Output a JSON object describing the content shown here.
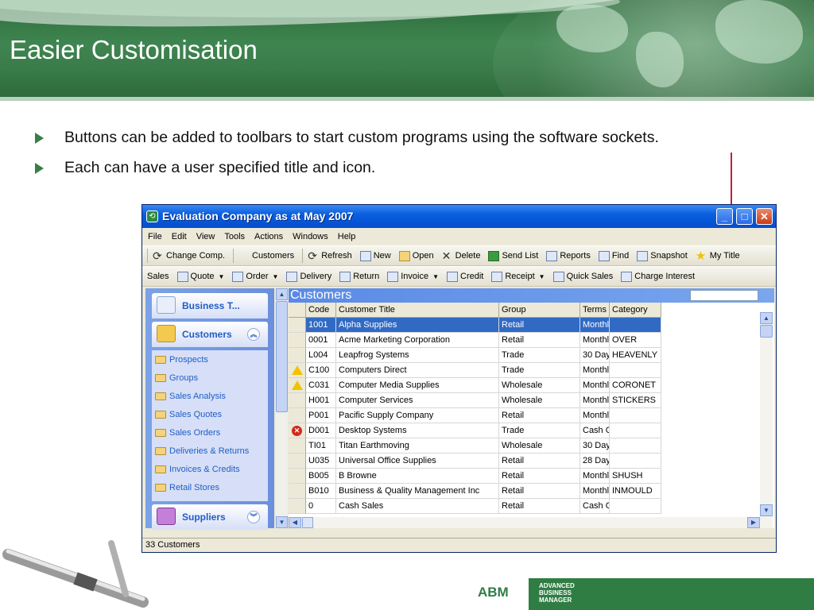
{
  "slide": {
    "title": "Easier Customisation",
    "bullets": [
      "Buttons can be added to toolbars to start custom programs using the software sockets.",
      "Each can have a user specified title and icon."
    ]
  },
  "window": {
    "title": "Evaluation Company as at May 2007",
    "menu": [
      "File",
      "Edit",
      "View",
      "Tools",
      "Actions",
      "Windows",
      "Help"
    ],
    "toolbar1": [
      {
        "label": "Change Comp.",
        "icon": "refresh-icon"
      },
      {
        "label": "Customers",
        "icon": "none"
      },
      {
        "label": "Refresh",
        "icon": "refresh-icon"
      },
      {
        "label": "New",
        "icon": "new-document-icon"
      },
      {
        "label": "Open",
        "icon": "folder-open-icon"
      },
      {
        "label": "Delete",
        "icon": "delete-icon"
      },
      {
        "label": "Send List",
        "icon": "excel-icon"
      },
      {
        "label": "Reports",
        "icon": "printer-icon"
      },
      {
        "label": "Find",
        "icon": "find-icon"
      },
      {
        "label": "Snapshot",
        "icon": "camera-icon"
      },
      {
        "label": "My Title",
        "icon": "star-icon"
      }
    ],
    "toolbar2": [
      {
        "label": "Sales",
        "dropdown": false
      },
      {
        "label": "Quote",
        "dropdown": true
      },
      {
        "label": "Order",
        "dropdown": true
      },
      {
        "label": "Delivery",
        "dropdown": false
      },
      {
        "label": "Return",
        "dropdown": false
      },
      {
        "label": "Invoice",
        "dropdown": true
      },
      {
        "label": "Credit",
        "dropdown": false
      },
      {
        "label": "Receipt",
        "dropdown": true
      },
      {
        "label": "Quick Sales",
        "dropdown": false
      },
      {
        "label": "Charge Interest",
        "dropdown": false
      }
    ],
    "sidebar": {
      "top_group": "Business T...",
      "group": "Customers",
      "items": [
        "Prospects",
        "Groups",
        "Sales Analysis",
        "Sales Quotes",
        "Sales Orders",
        "Deliveries & Returns",
        "Invoices & Credits",
        "Retail Stores"
      ],
      "bottom_group": "Suppliers"
    },
    "grid": {
      "title": "Customers",
      "columns": [
        "Code",
        "Customer Title",
        "Group",
        "Terms",
        "Category"
      ],
      "rows": [
        {
          "flag": "",
          "code": "1001",
          "title": "Alpha Supplies",
          "group": "Retail",
          "terms": "Monthly",
          "category": "",
          "selected": true
        },
        {
          "flag": "",
          "code": "0001",
          "title": "Acme Marketing Corporation",
          "group": "Retail",
          "terms": "Monthly",
          "category": "OVER",
          "selected": false
        },
        {
          "flag": "",
          "code": "L004",
          "title": "Leapfrog Systems",
          "group": "Trade",
          "terms": "30 Day",
          "category": "HEAVENLY",
          "selected": false
        },
        {
          "flag": "warning",
          "code": "C100",
          "title": "Computers Direct",
          "group": "Trade",
          "terms": "Monthly",
          "category": "",
          "selected": false
        },
        {
          "flag": "warning",
          "code": "C031",
          "title": "Computer Media Supplies",
          "group": "Wholesale",
          "terms": "Monthly",
          "category": "CORONET",
          "selected": false
        },
        {
          "flag": "",
          "code": "H001",
          "title": "Computer Services",
          "group": "Wholesale",
          "terms": "Monthly",
          "category": "STICKERS",
          "selected": false
        },
        {
          "flag": "",
          "code": "P001",
          "title": "Pacific Supply Company",
          "group": "Retail",
          "terms": "Monthly",
          "category": "",
          "selected": false
        },
        {
          "flag": "error",
          "code": "D001",
          "title": "Desktop Systems",
          "group": "Trade",
          "terms": "Cash O",
          "category": "",
          "selected": false
        },
        {
          "flag": "",
          "code": "TI01",
          "title": "Titan Earthmoving",
          "group": "Wholesale",
          "terms": "30 Day",
          "category": "",
          "selected": false
        },
        {
          "flag": "",
          "code": "U035",
          "title": "Universal Office Supplies",
          "group": "Retail",
          "terms": "28 Day",
          "category": "",
          "selected": false
        },
        {
          "flag": "",
          "code": "B005",
          "title": "B Browne",
          "group": "Retail",
          "terms": "Monthly",
          "category": "SHUSH",
          "selected": false
        },
        {
          "flag": "",
          "code": "B010",
          "title": "Business & Quality Management Inc",
          "group": "Retail",
          "terms": "Monthly",
          "category": "INMOULD",
          "selected": false
        },
        {
          "flag": "",
          "code": "0",
          "title": "Cash Sales",
          "group": "Retail",
          "terms": "Cash O",
          "category": "",
          "selected": false
        }
      ]
    },
    "status": "33 Customers"
  },
  "footer": {
    "logo": "ABM",
    "logo_lines": [
      "ADVANCED",
      "BUSINESS",
      "MANAGER"
    ]
  },
  "colors": {
    "header_green": "#3a7c4a",
    "selection_blue": "#316ac5",
    "callout_red": "#c0203a"
  }
}
